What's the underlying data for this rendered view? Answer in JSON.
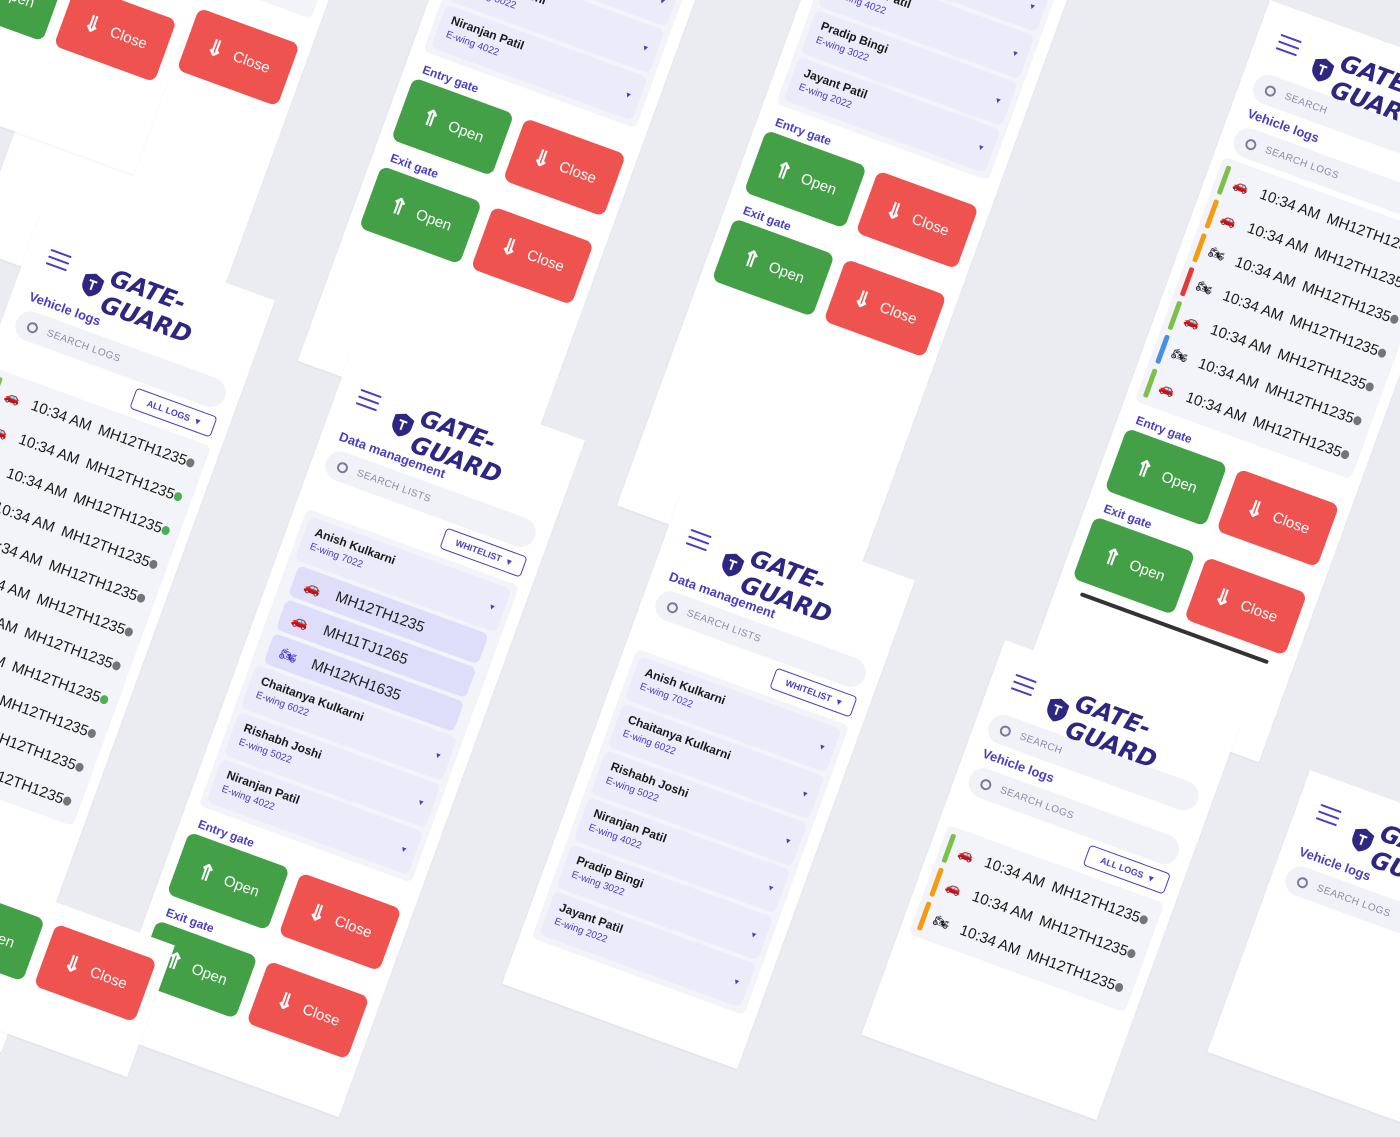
{
  "brand": "GATE-GUARD",
  "labels": {
    "vehicle_logs": "Vehicle logs",
    "data_management": "Data management",
    "search": "SEARCH",
    "search_logs": "SEARCH LOGS",
    "search_lists": "SEARCH LISTS",
    "all_logs": "ALL LOGS",
    "whitelist": "WHITELIST",
    "entry_gate": "Entry gate",
    "exit_gate": "Exit gate",
    "open": "Open",
    "close": "Close"
  },
  "log_time": "10:34 AM",
  "log_plate": "MH12TH1235",
  "colors": {
    "accent": "#4a3ec2",
    "brand": "#2d2682",
    "open": "#43a047",
    "close": "#ef5350",
    "status_green": "#4caf50",
    "status_grey": "#757575",
    "bar_green": "#7cc04a",
    "bar_blue": "#4a90e2",
    "bar_orange": "#f39c12",
    "bar_red": "#e53935"
  },
  "people": [
    {
      "name": "Anish Kulkarni",
      "wing": "E-wing 7022"
    },
    {
      "name": "Chaitanya Kulkarni",
      "wing": "E-wing 6022"
    },
    {
      "name": "Rishabh Joshi",
      "wing": "E-wing 5022"
    },
    {
      "name": "Niranjan Patil",
      "wing": "E-wing 4022"
    },
    {
      "name": "Pradip Bingi",
      "wing": "E-wing 3022"
    },
    {
      "name": "Jayant Patil",
      "wing": "E-wing 2022"
    }
  ],
  "vehicles": [
    "MH12TH1235",
    "MH11TJ1265",
    "MH12KH1635"
  ]
}
